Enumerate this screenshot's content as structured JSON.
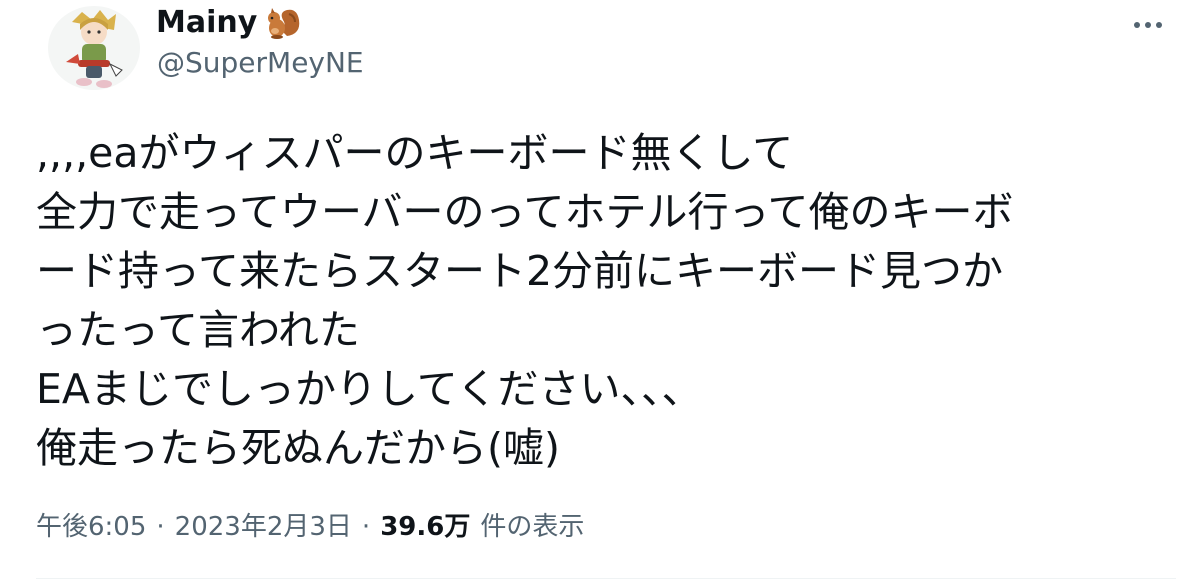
{
  "tweet": {
    "author": {
      "display_name": "Mainy",
      "emoji_icon": "squirrel-icon",
      "handle": "@SuperMeyNE"
    },
    "more_icon": "more-options-icon",
    "text_lines": [
      ",,,,eaがウィスパーのキーボード無くして",
      "全力で走ってウーバーのってホテル行って俺のキーボ",
      "ード持って来たらスタート2分前にキーボード見つか",
      "ったって言われた",
      "EAまじでしっかりしてください、、、",
      "俺走ったら死ぬんだから(嘘)"
    ],
    "meta": {
      "time": "午後6:05",
      "separator": "·",
      "date": "2023年2月3日",
      "views_count": "39.6万",
      "views_label": "件の表示"
    }
  },
  "colors": {
    "text_primary": "#0f1419",
    "text_secondary": "#536471",
    "divider": "#eff3f4"
  }
}
